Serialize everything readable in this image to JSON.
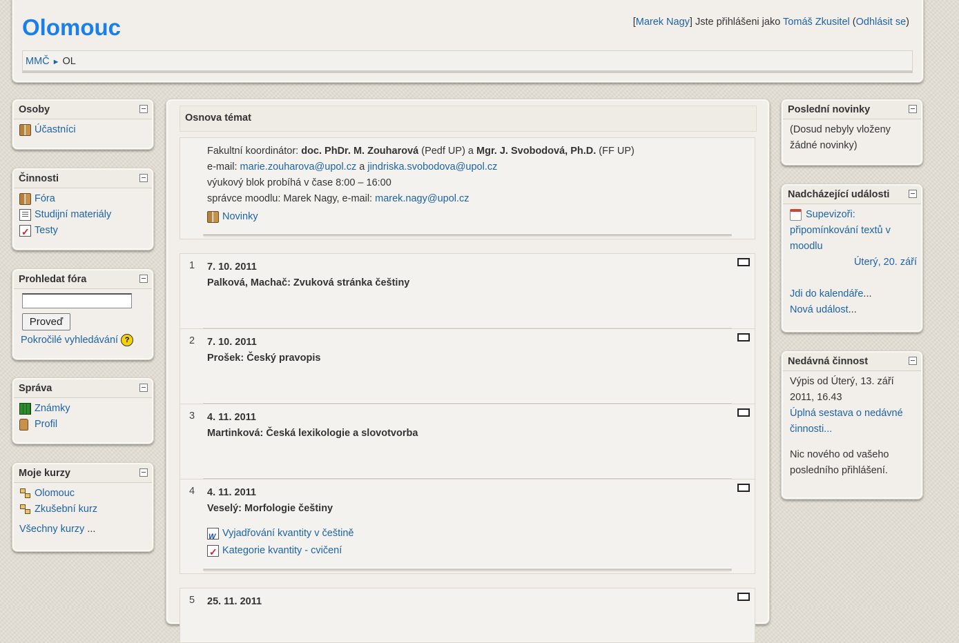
{
  "site_title": "Olomouc",
  "login": {
    "lb": "[",
    "user_link": "Marek Nagy",
    "mid": "] Jste přihlášeni jako ",
    "as_user": "Tomáš Zkusitel",
    "paren_open": " (",
    "logout": "Odhlásit se",
    "paren_close": ")"
  },
  "breadcrumb": {
    "home": "MMČ",
    "sep": "►",
    "current": "OL"
  },
  "blocks": {
    "people": {
      "title": "Osoby",
      "participants": "Účastníci"
    },
    "activities": {
      "title": "Činnosti",
      "forums": "Fóra",
      "resources": "Studijní materiály",
      "quizzes": "Testy"
    },
    "search": {
      "title": "Prohledat fóra",
      "input_value": "",
      "submit": "Proveď",
      "advanced": "Pokročilé vyhledávání",
      "help": "?"
    },
    "admin": {
      "title": "Správa",
      "grades": "Známky",
      "profile": "Profil"
    },
    "mycourses": {
      "title": "Moje kurzy",
      "course1": "Olomouc",
      "course2": "Zkušební kurz",
      "all": "Všechny kurzy",
      "all_suffix": " ..."
    },
    "news": {
      "title": "Poslední novinky",
      "text": "(Dosud nebyly vloženy žádné novinky)"
    },
    "events": {
      "title": "Nadcházející události",
      "event_name": "Supevizoři: připomínkování textů v moodlu",
      "event_date": "Úterý, 20. září",
      "calendar": "Jdi do kalendáře",
      "calendar_suffix": "...",
      "new_event": "Nová událost",
      "new_event_suffix": "..."
    },
    "recent": {
      "title": "Nedávná činnost",
      "since": "Výpis od Úterý, 13. září 2011, 16.43",
      "full_report": "Úplná sestava o nedávné činnosti...",
      "nothing": "Nic nového od vašeho posledního přihlášení."
    }
  },
  "main": {
    "title": "Osnova témat",
    "intro": {
      "coord_label": "Fakultní koordinátor: ",
      "coord1": "doc. PhDr. M. Zouharová",
      "coord1_aff": " (Pedf UP) a ",
      "coord2": "Mgr. J. Svobodová, Ph.D.",
      "coord2_aff": " (FF UP)",
      "email_label": "e-mail: ",
      "email1": "marie.zouharova@upol.cz",
      "email_and": " a ",
      "email2": "jindriska.svobodova@upol.cz",
      "block_time": "výukový blok probíhá v čase 8:00 – 16:00",
      "admin_label": "správce moodlu: Marek Nagy, e-mail: ",
      "admin_email": "marek.nagy@upol.cz",
      "news_forum": "Novinky"
    },
    "sections": [
      {
        "num": "1",
        "date": "7. 10. 2011",
        "title": "Palková, Machač: Zvuková stránka češtiny"
      },
      {
        "num": "2",
        "date": "7. 10. 2011",
        "title": "Prošek: Český pravopis"
      },
      {
        "num": "3",
        "date": "4. 11. 2011",
        "title": "Martinková: Česká lexikologie a slovotvorba"
      },
      {
        "num": "4",
        "date": "4. 11. 2011",
        "title": "Veselý: Morfologie češtiny",
        "resources": [
          "Vyjadřování kvantity v češtině",
          "Kategorie kvantity - cvičení"
        ]
      },
      {
        "num": "5",
        "date": "25. 11. 2011"
      }
    ]
  }
}
